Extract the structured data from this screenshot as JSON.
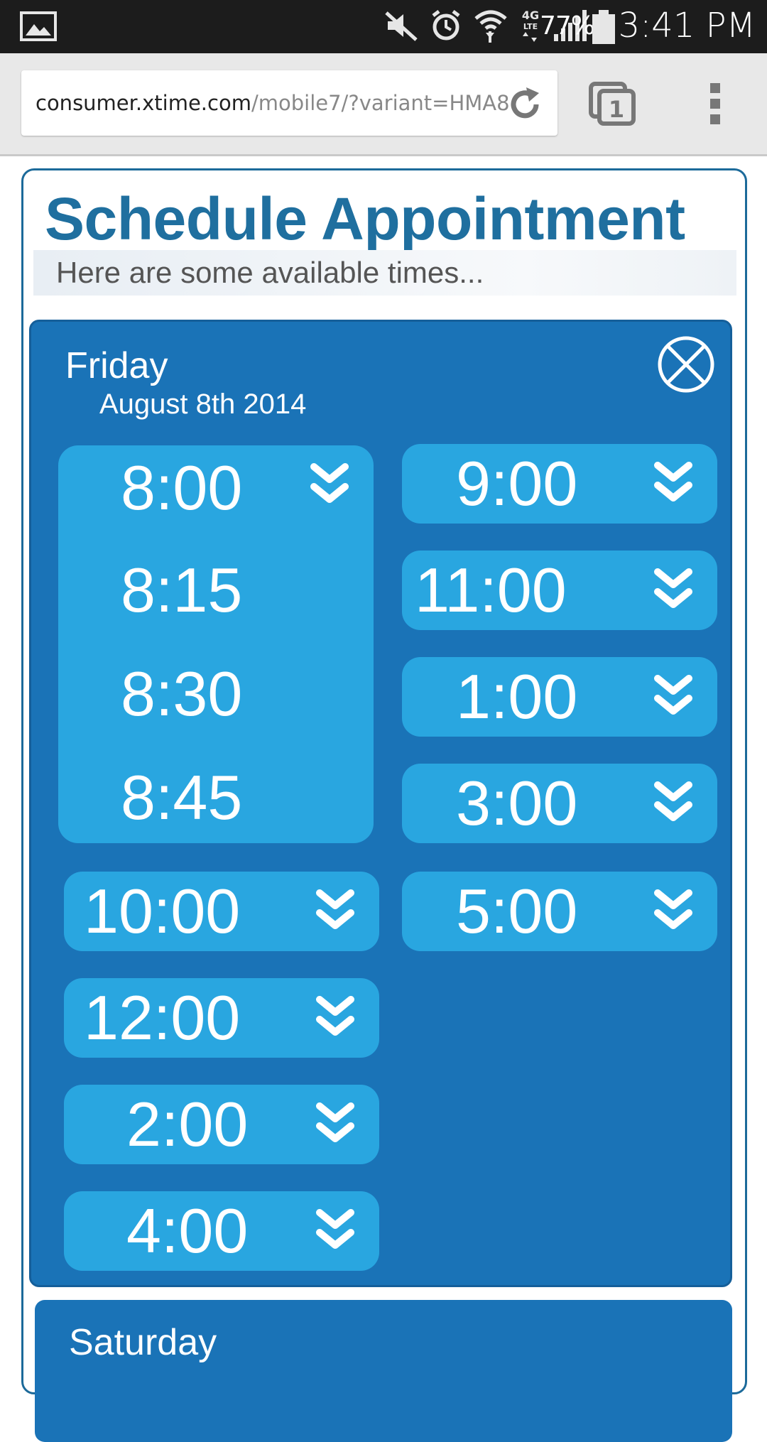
{
  "status_bar": {
    "battery_percent": "77%",
    "time": "3:41 PM",
    "network_label": "4G LTE"
  },
  "browser": {
    "url_domain": "consumer.xtime.com",
    "url_path": "/mobile7/?variant=HMA8",
    "tab_count": "1"
  },
  "page": {
    "title": "Schedule Appointment",
    "subtitle": "Here are some available times..."
  },
  "day": {
    "name": "Friday",
    "date": "August 8th 2014",
    "expanded_slot": {
      "time": "8:00",
      "sub_times": [
        "8:15",
        "8:30",
        "8:45"
      ]
    },
    "left_slots": [
      "10:00",
      "12:00",
      "2:00",
      "4:00"
    ],
    "right_slots": [
      "9:00",
      "11:00",
      "1:00",
      "3:00",
      "5:00"
    ]
  },
  "next_day": {
    "name": "Saturday"
  },
  "colors": {
    "panel_blue": "#1a73b7",
    "slot_blue": "#29a6e0",
    "title_blue": "#1f6f9f"
  }
}
